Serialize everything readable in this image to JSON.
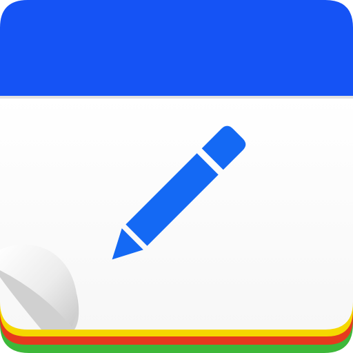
{
  "icon": {
    "name": "notepad-pencil-app-icon",
    "colors": {
      "header": "#1553F5",
      "pencil": "#1469F4",
      "sheet": "#FFFFFF",
      "sheet_shadow": "#E9E9E9",
      "curl": "#D9D9D9",
      "stack_yellow": "#F5D800",
      "stack_red": "#E63A1E",
      "stack_green": "#3DB83A"
    }
  }
}
